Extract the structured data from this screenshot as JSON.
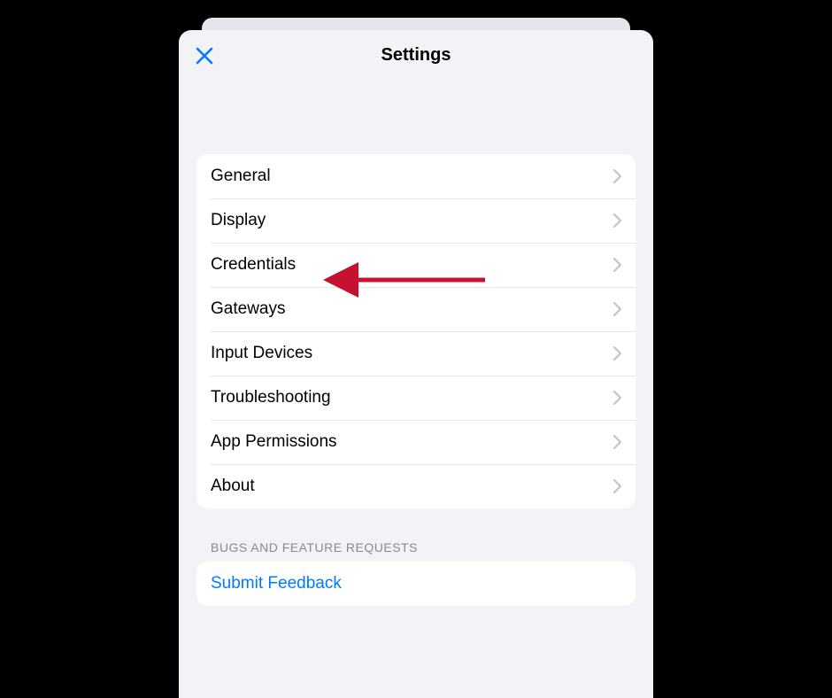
{
  "header": {
    "title": "Settings",
    "close_icon": "close"
  },
  "menu": {
    "items": [
      {
        "label": "General"
      },
      {
        "label": "Display"
      },
      {
        "label": "Credentials"
      },
      {
        "label": "Gateways"
      },
      {
        "label": "Input Devices"
      },
      {
        "label": "Troubleshooting"
      },
      {
        "label": "App Permissions"
      },
      {
        "label": "About"
      }
    ]
  },
  "feedback": {
    "section_title": "Bugs and Feature Requests",
    "submit_label": "Submit Feedback"
  },
  "annotation": {
    "target": "Credentials",
    "arrow_color": "#c41230"
  }
}
